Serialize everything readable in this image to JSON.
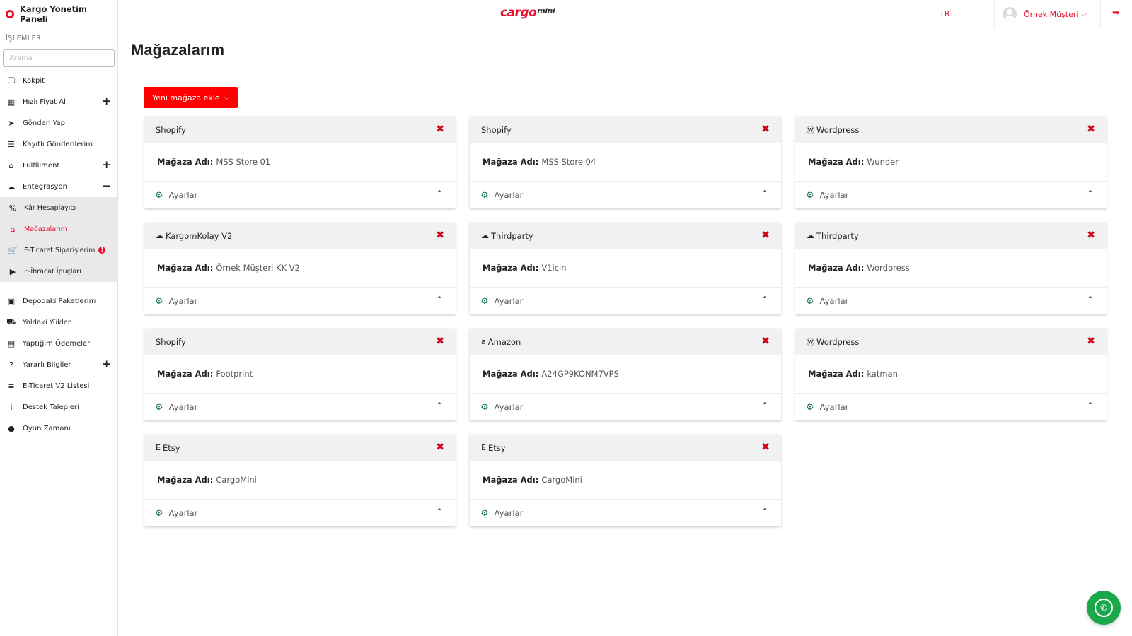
{
  "sidebar": {
    "title": "Kargo Yönetim Paneli",
    "section": "İŞLEMLER",
    "search_placeholder": "Arama",
    "items": [
      {
        "label": "Kokpit",
        "icon": "monitor-icon",
        "toggle": ""
      },
      {
        "label": "Hızlı Fiyat Al",
        "icon": "calculator-icon",
        "toggle": "+"
      },
      {
        "label": "Gönderi Yap",
        "icon": "paper-plane-icon",
        "toggle": ""
      },
      {
        "label": "Kayıtlı Gönderilerim",
        "icon": "list-icon",
        "toggle": ""
      },
      {
        "label": "Fulfillment",
        "icon": "warehouse-icon",
        "toggle": "+"
      },
      {
        "label": "Entegrasyon",
        "icon": "cloud-icon",
        "toggle": "−"
      }
    ],
    "sub_items": [
      {
        "label": "Kâr Hesaplayıcı",
        "icon": "percent-icon"
      },
      {
        "label": "Mağazalarım",
        "icon": "store-icon"
      },
      {
        "label": "E-Ticaret Siparişlerim",
        "icon": "cart-icon",
        "badge": "!"
      },
      {
        "label": "E-İhracat İpuçları",
        "icon": "play-icon"
      }
    ],
    "items2": [
      {
        "label": "Depodaki Paketlerim",
        "icon": "boxes-icon",
        "toggle": ""
      },
      {
        "label": "Yoldaki Yükler",
        "icon": "truck-icon",
        "toggle": ""
      },
      {
        "label": "Yaptığım Ödemeler",
        "icon": "money-icon",
        "toggle": ""
      },
      {
        "label": "Yararlı Bilgiler",
        "icon": "question-icon",
        "toggle": "+"
      },
      {
        "label": "E-Ticaret V2 Listesi",
        "icon": "file-icon",
        "toggle": ""
      },
      {
        "label": "Destek Talepleri",
        "icon": "info-icon",
        "toggle": ""
      },
      {
        "label": "Oyun Zamanı",
        "icon": "gamepad-icon",
        "toggle": ""
      }
    ]
  },
  "topbar": {
    "brand": "cargo",
    "brand_suffix": "mini",
    "lang": "TR",
    "user": "Örnek Müşteri"
  },
  "page": {
    "title": "Mağazalarım",
    "add_button": "Yeni mağaza ekle"
  },
  "store_label": "Mağaza Adı:",
  "settings_label": "Ayarlar",
  "stores": [
    {
      "platform": "Shopify",
      "icon": "",
      "name": "MSS Store 01"
    },
    {
      "platform": "Shopify",
      "icon": "",
      "name": "MSS Store 04"
    },
    {
      "platform": "Wordpress",
      "icon": "wordpress-icon",
      "name": "Wunder"
    },
    {
      "platform": "KargomKolay V2",
      "icon": "cloud-icon",
      "name": "Örnek Müşteri KK V2"
    },
    {
      "platform": "Thirdparty",
      "icon": "cloud-icon",
      "name": "V1icin"
    },
    {
      "platform": "Thirdparty",
      "icon": "cloud-icon",
      "name": "Wordpress"
    },
    {
      "platform": "Shopify",
      "icon": "",
      "name": "Footprint"
    },
    {
      "platform": "Amazon",
      "icon": "amazon-icon",
      "name": "A24GP9KONM7VPS"
    },
    {
      "platform": "Wordpress",
      "icon": "wordpress-icon",
      "name": "katman"
    },
    {
      "platform": "Etsy",
      "icon": "etsy-icon",
      "name": "CargoMini"
    },
    {
      "platform": "Etsy",
      "icon": "etsy-icon",
      "name": "CargoMini"
    }
  ],
  "colors": {
    "accent": "#e8112d",
    "button": "#ff0000",
    "gear": "#1f7a4d",
    "whatsapp": "#1ba84a"
  }
}
